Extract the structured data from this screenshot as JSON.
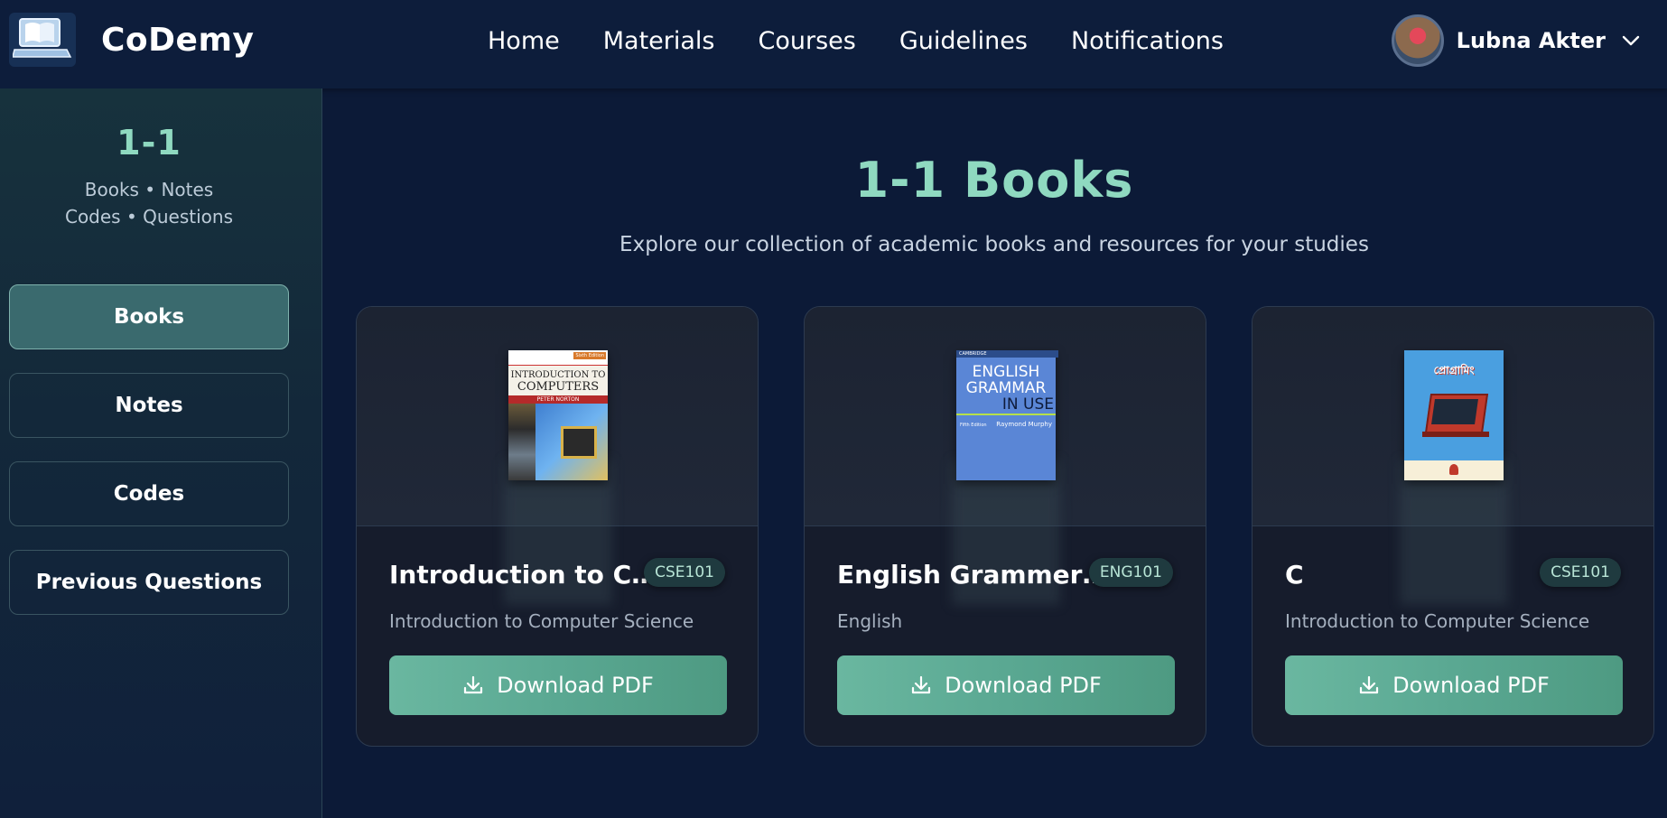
{
  "app": {
    "name": "CoDemy"
  },
  "nav": [
    "Home",
    "Materials",
    "Courses",
    "Guidelines",
    "Notifications"
  ],
  "user": {
    "name": "Lubna Akter"
  },
  "sidebar": {
    "title": "1-1",
    "subtitle_line1": "Books • Notes",
    "subtitle_line2": "Codes • Questions",
    "items": [
      {
        "label": "Books",
        "active": true
      },
      {
        "label": "Notes",
        "active": false
      },
      {
        "label": "Codes",
        "active": false
      },
      {
        "label": "Previous Questions",
        "active": false
      }
    ]
  },
  "main": {
    "title": "1-1 Books",
    "subtitle": "Explore our collection of academic books and resources for your studies"
  },
  "books": [
    {
      "title": "Introduction to Co...",
      "code": "CSE101",
      "subject": "Introduction to Computer Science",
      "download_label": "Download PDF",
      "cover": {
        "line1": "INTRODUCTION TO",
        "line2": "COMPUTERS",
        "author": "PETER NORTON",
        "edition": "Sixth Edition"
      }
    },
    {
      "title": "English Grammer i...",
      "code": "ENG101",
      "subject": "English",
      "download_label": "Download PDF",
      "cover": {
        "publisher": "CAMBRIDGE",
        "line1": "ENGLISH",
        "line2": "GRAMMAR",
        "line3": "IN USE",
        "author": "Raymond Murphy",
        "edition": "Fifth Edition"
      }
    },
    {
      "title": "C",
      "code": "CSE101",
      "subject": "Introduction to Computer Science",
      "download_label": "Download PDF",
      "cover": {
        "line1": "প্রোগ্রামিং"
      }
    }
  ],
  "colors": {
    "accent": "#8fd9c0",
    "button": "#5aa892",
    "background": "#0c1a37"
  }
}
